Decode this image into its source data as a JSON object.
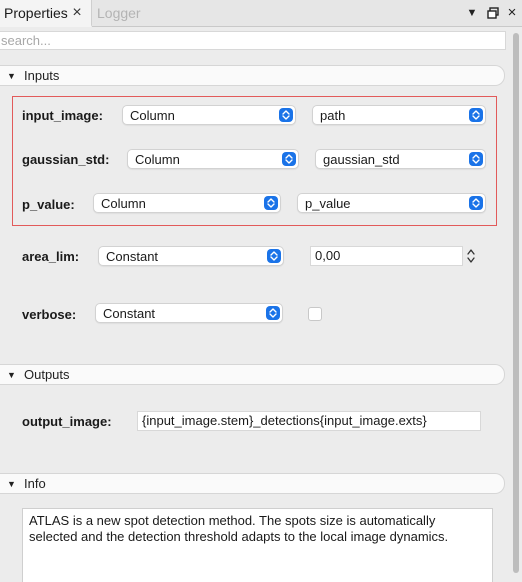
{
  "tabs": [
    {
      "label": "Properties"
    },
    {
      "label": "Logger"
    }
  ],
  "window_controls": {
    "menu_icon": "triangle-down-icon",
    "float_icon": "float-window-icon",
    "close_icon": "close-icon"
  },
  "search": {
    "placeholder": "search...",
    "value": ""
  },
  "sections": {
    "inputs": "Inputs",
    "outputs": "Outputs",
    "info": "Info"
  },
  "inputs": {
    "input_image": {
      "label": "input_image:",
      "mode": "Column",
      "value": "path"
    },
    "gaussian_std": {
      "label": "gaussian_std:",
      "mode": "Column",
      "value": "gaussian_std"
    },
    "p_value": {
      "label": "p_value:",
      "mode": "Column",
      "value": "p_value"
    },
    "area_lim": {
      "label": "area_lim:",
      "mode": "Constant",
      "value": "0,00"
    },
    "verbose": {
      "label": "verbose:",
      "mode": "Constant",
      "checked": false
    }
  },
  "outputs": {
    "output_image": {
      "label": "output_image:",
      "value": "{input_image.stem}_detections{input_image.exts}"
    }
  },
  "info": {
    "text": "ATLAS is a new spot detection method. The spots size is automatically selected and the detection threshold adapts to the local image dynamics."
  },
  "colors": {
    "accent": "#1a73e8",
    "highlight_border": "#e25a5a"
  }
}
